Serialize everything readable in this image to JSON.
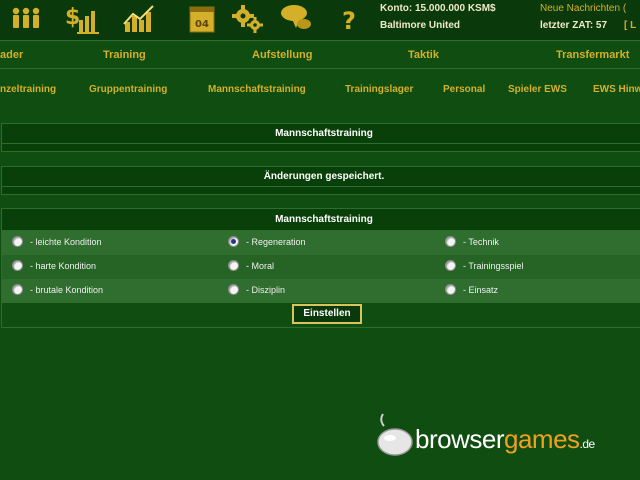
{
  "account": {
    "balance": "Konto: 15.000.000 KSM$",
    "team": "Baltimore United",
    "messages": "Neue Nachrichten (",
    "last_zat": "letzter ZAT: 57",
    "last_zat_extra": "[ L"
  },
  "icons": [
    "team-icon",
    "finance-icon",
    "stats-icon",
    "calendar-icon",
    "settings-gears-icon",
    "chat-icon",
    "help-icon"
  ],
  "calendar_day": "04",
  "nav_main": [
    "ader",
    "Training",
    "Aufstellung",
    "Taktik",
    "Transfermarkt"
  ],
  "nav_sub": [
    "nzeltraining",
    "Gruppentraining",
    "Mannschaftstraining",
    "Trainingslager",
    "Personal",
    "Spieler EWS",
    "EWS Hinw"
  ],
  "header_title": "Mannschaftstraining",
  "status_message": "Änderungen gespeichert.",
  "form": {
    "title": "Mannschaftstraining",
    "options": [
      [
        "- leichte Kondition",
        "- Regeneration",
        "- Technik"
      ],
      [
        "- harte Kondition",
        "- Moral",
        "- Trainingsspiel"
      ],
      [
        "- brutale Kondition",
        "- Disziplin",
        "- Einsatz"
      ]
    ],
    "selected": "- Regeneration",
    "submit_label": "Einstellen"
  },
  "watermark": {
    "main": "browser",
    "accent": "games",
    "tld": ".de"
  },
  "colors": {
    "background": "#0f4d10",
    "accent": "#d4b02a",
    "button_border": "#d8c45a"
  }
}
